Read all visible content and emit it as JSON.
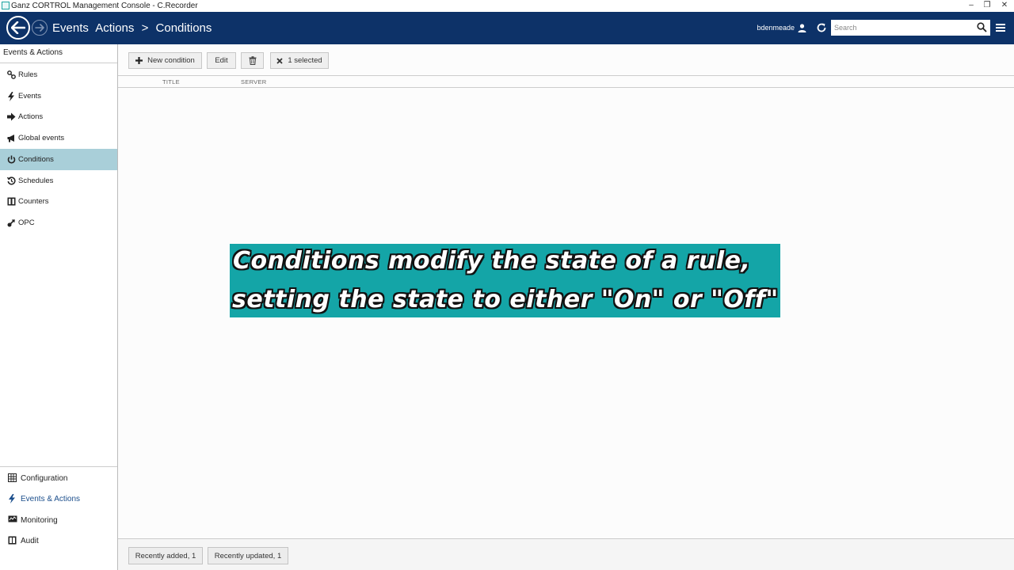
{
  "window": {
    "title": "Ganz CORTROL Management Console - C.Recorder",
    "minimize": "–",
    "restore": "❐",
    "close": "✕"
  },
  "header": {
    "breadcrumb": [
      "Events",
      "Actions",
      ">",
      "Conditions"
    ],
    "username": "bdenmeade",
    "search_placeholder": "Search"
  },
  "sidebar": {
    "heading": "Events & Actions",
    "items": [
      {
        "label": "Rules",
        "icon": "link-icon"
      },
      {
        "label": "Events",
        "icon": "lightning-icon"
      },
      {
        "label": "Actions",
        "icon": "arrow-right-icon"
      },
      {
        "label": "Global events",
        "icon": "megaphone-icon"
      },
      {
        "label": "Conditions",
        "icon": "power-icon",
        "active": true
      },
      {
        "label": "Schedules",
        "icon": "clock-history-icon"
      },
      {
        "label": "Counters",
        "icon": "counter-icon"
      },
      {
        "label": "OPC",
        "icon": "connector-icon"
      }
    ],
    "bottom_nav": [
      {
        "label": "Configuration",
        "icon": "grid-icon"
      },
      {
        "label": "Events & Actions",
        "icon": "lightning-icon",
        "active": true
      },
      {
        "label": "Monitoring",
        "icon": "monitor-icon"
      },
      {
        "label": "Audit",
        "icon": "book-icon"
      }
    ]
  },
  "toolbar": {
    "new_label": "New condition",
    "edit_label": "Edit",
    "selected_label": "1 selected"
  },
  "table": {
    "columns": [
      "TITLE",
      "SERVER"
    ]
  },
  "overlay": {
    "line1": "Conditions modify the state of a rule,",
    "line2": "setting the state to either \"On\" or \"Off\""
  },
  "status": {
    "recently_added": "Recently added, 1",
    "recently_updated": "Recently updated, 1"
  },
  "colors": {
    "header_bg": "#0d3268",
    "active_item_bg": "#a9cfd9",
    "overlay_bg": "#14a5a7"
  }
}
